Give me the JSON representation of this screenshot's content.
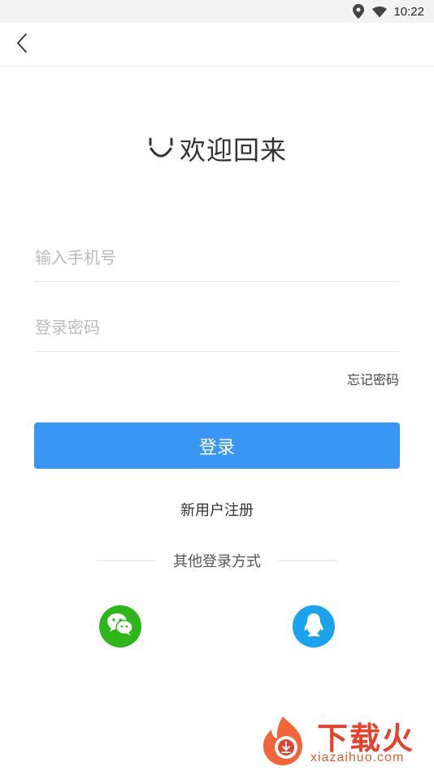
{
  "status_bar": {
    "time": "10:22",
    "icons": [
      "location-icon",
      "wifi-icon"
    ]
  },
  "nav": {
    "back_icon": "chevron-left-icon"
  },
  "header": {
    "title": "欢迎回来",
    "icon": "smile-icon"
  },
  "form": {
    "phone_placeholder": "输入手机号",
    "phone_value": "",
    "password_placeholder": "登录密码",
    "password_value": "",
    "forgot_password": "忘记密码",
    "login_button": "登录",
    "register_link": "新用户注册"
  },
  "other_login": {
    "label": "其他登录方式",
    "providers": [
      {
        "name": "wechat",
        "icon": "wechat-icon",
        "color": "#2cb61a"
      },
      {
        "name": "qq",
        "icon": "qq-icon",
        "color": "#1aa2ec"
      }
    ]
  },
  "watermark": {
    "brand": "下载火",
    "url": "xiazaihuo.com"
  },
  "colors": {
    "accent": "#3a96f5",
    "wechat": "#2cb61a",
    "qq": "#1aa2ec",
    "watermark": "#e8402a"
  }
}
